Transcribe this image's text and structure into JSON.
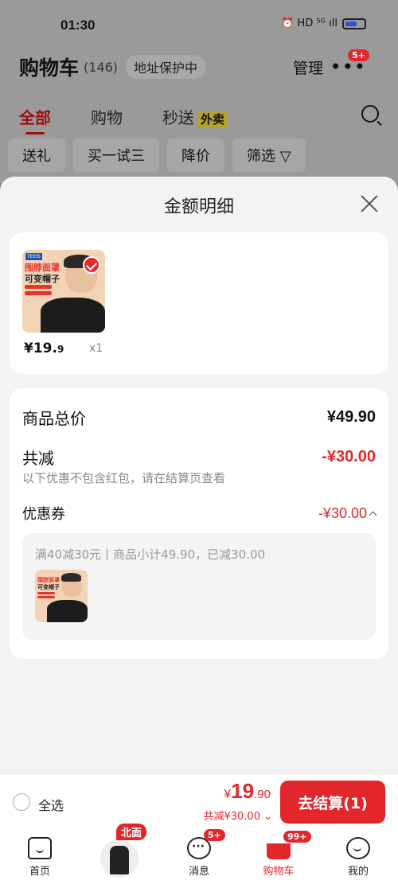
{
  "status_bar": {
    "time": "01:30",
    "icons": "⏰ HD ⁵ᴳ ıll"
  },
  "cart_header": {
    "title": "购物车",
    "count": "(146)",
    "address": "地址保护中",
    "manage": "管理",
    "more_badge": "5+"
  },
  "cart_tabs": {
    "all": "全部",
    "shopping": "购物",
    "flash": "秒送",
    "flash_tag": "外卖"
  },
  "filters": [
    "送礼",
    "买一试三",
    "降价",
    "筛选 ▽"
  ],
  "sheet": {
    "title": "金额明细",
    "item": {
      "brand": "TEEIS",
      "promo_line1": "围脖面罩",
      "promo_line2": "可变帽子",
      "price_main": "¥19.",
      "price_decimal": "9",
      "qty": "x1"
    },
    "detail": {
      "goods_total_label": "商品总价",
      "goods_total_value": "¥49.90",
      "reduction_label": "共减",
      "reduction_value": "-¥30.00",
      "reduction_hint": "以下优惠不包含红包，请在结算页查看",
      "coupon_label": "优惠券",
      "coupon_value": "-¥30.00",
      "coupon_desc": "满40减30元丨商品小计49.90，已减30.00"
    }
  },
  "checkout": {
    "select_all": "全选",
    "total_yen": "¥",
    "total_int": "19",
    "total_dec": ".90",
    "saving": "共减¥30.00 ⌄",
    "button": "去结算(1)"
  },
  "bottom_nav": {
    "home": "首页",
    "ad_badge": "北面",
    "messages": "消息",
    "messages_badge": "5+",
    "cart": "购物车",
    "cart_badge": "99+",
    "me": "我的"
  },
  "colors": {
    "accent": "#e3262c",
    "sheet_bg": "#f3f3f3",
    "dim_bg": "#9a9a9a"
  }
}
